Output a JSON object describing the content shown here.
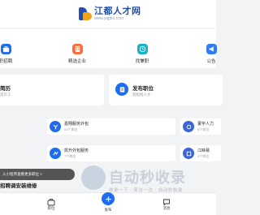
{
  "header": {
    "logo_title": "江都人才网",
    "logo_sub": "www.yqjdrc.com"
  },
  "quick_nav": [
    {
      "label": "职招聘",
      "icon": "briefcase-icon",
      "color": "#1e6cf0"
    },
    {
      "label": "精选企业",
      "icon": "building-icon",
      "color": "#ff6b3d"
    },
    {
      "label": "找兼职",
      "icon": "parttime-icon",
      "color": "#17b0c9"
    },
    {
      "label": "公告",
      "icon": "megaphone-icon",
      "color": "#2f7cf6"
    }
  ],
  "cards": {
    "resume": {
      "title": "简历",
      "sub": "首页工"
    },
    "post_job": {
      "title": "发布职位",
      "sub": "轻松招人才"
    }
  },
  "companies": [
    {
      "name": "嘉翔服务外包",
      "count": "53个岗位",
      "color": "#1e6cf0",
      "icon": "company-logo-icon"
    },
    {
      "name": "寰宇人力",
      "count": "5个岗位",
      "color": "#3a66d8",
      "icon": "company-logo-icon"
    },
    {
      "name": "凯升外包服务",
      "count": "7个岗位",
      "color": "#1e6cf0",
      "icon": "company-logo-icon"
    },
    {
      "name": "江映易",
      "count": "4个岗位",
      "color": "#3a66d8",
      "icon": "company-logo-icon"
    }
  ],
  "notice": "入小程序查看更多职位 >",
  "section_title": "招聘调安装维修",
  "watermark": {
    "main": "自动秒收录",
    "sub": "收录一下 · 来访一次 · 自动秒收录"
  },
  "tabbar": [
    {
      "label": "职位",
      "icon": "briefcase-tab-icon"
    },
    {
      "label": "发布",
      "icon": "plus-icon"
    },
    {
      "label": "消息",
      "icon": "message-icon"
    }
  ]
}
